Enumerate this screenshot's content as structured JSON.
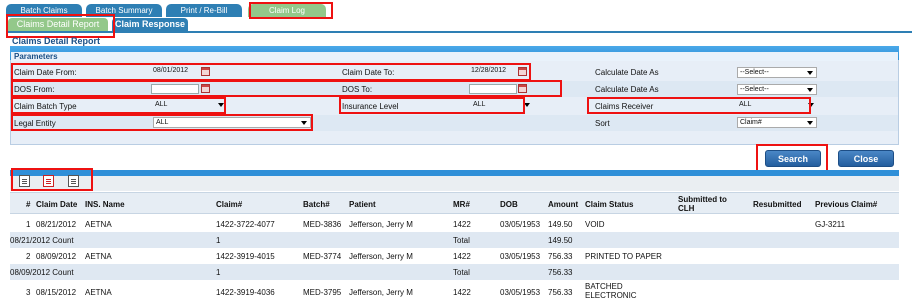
{
  "top_tabs": [
    "Batch Claims",
    "Batch Summary",
    "Print / Re-Bill",
    "Claim Log"
  ],
  "sub_tabs": [
    "Claims Detail Report",
    "Claim Response"
  ],
  "panel_title": "Claims Detail Report",
  "params_label": "Parameters",
  "fields": {
    "claim_date_from": {
      "label": "Claim Date From:",
      "value": "08/01/2012"
    },
    "claim_date_to": {
      "label": "Claim Date To:",
      "value": "12/28/2012"
    },
    "dos_from": {
      "label": "DOS From:",
      "value": ""
    },
    "dos_to": {
      "label": "DOS To:",
      "value": ""
    },
    "calc_date_1": {
      "label": "Calculate Date As",
      "value": "--Select--"
    },
    "calc_date_2": {
      "label": "Calculate Date As",
      "value": "--Select--"
    },
    "claim_batch_type": {
      "label": "Claim Batch Type",
      "value": "ALL"
    },
    "insurance_level": {
      "label": "Insurance Level",
      "value": "ALL"
    },
    "claims_receiver": {
      "label": "Claims Receiver",
      "value": "ALL"
    },
    "legal_entity": {
      "label": "Legal Entity",
      "value": "ALL"
    },
    "sort": {
      "label": "Sort",
      "value": "Claim#"
    }
  },
  "buttons": {
    "search": "Search",
    "close": "Close"
  },
  "table": {
    "columns": [
      "#",
      "Claim Date",
      "INS. Name",
      "Claim#",
      "Batch#",
      "Patient",
      "MR#",
      "DOB",
      "Amount",
      "Claim Status",
      "Submitted to",
      "CLH",
      "Resubmitted",
      "Previous Claim#"
    ],
    "rows": [
      {
        "num": "1",
        "claim_date": "08/21/2012",
        "ins": "AETNA",
        "claim": "1422-3722-4077",
        "batch": "MED-3836",
        "patient": "Jefferson, Jerry M",
        "mr": "1422",
        "dob": "03/05/1953",
        "amount": "149.50",
        "status": "VOID",
        "status2": "",
        "resub": "",
        "prev": "GJ-3211"
      },
      {
        "count_label": "08/21/2012 Count",
        "count": "1",
        "total_label": "Total",
        "total": "149.50"
      },
      {
        "num": "2",
        "claim_date": "08/09/2012",
        "ins": "AETNA",
        "claim": "1422-3919-4015",
        "batch": "MED-3774",
        "patient": "Jefferson, Jerry M",
        "mr": "1422",
        "dob": "03/05/1953",
        "amount": "756.33",
        "status": "PRINTED TO PAPER",
        "status2": "",
        "resub": "",
        "prev": ""
      },
      {
        "count_label": "08/09/2012 Count",
        "count": "1",
        "total_label": "Total",
        "total": "756.33"
      },
      {
        "num": "3",
        "claim_date": "08/15/2012",
        "ins": "AETNA",
        "claim": "1422-3919-4036",
        "batch": "MED-3795",
        "patient": "Jefferson, Jerry M",
        "mr": "1422",
        "dob": "03/05/1953",
        "amount": "756.33",
        "status": "BATCHED",
        "status2": "ELECTRONIC",
        "resub": "",
        "prev": ""
      }
    ]
  }
}
